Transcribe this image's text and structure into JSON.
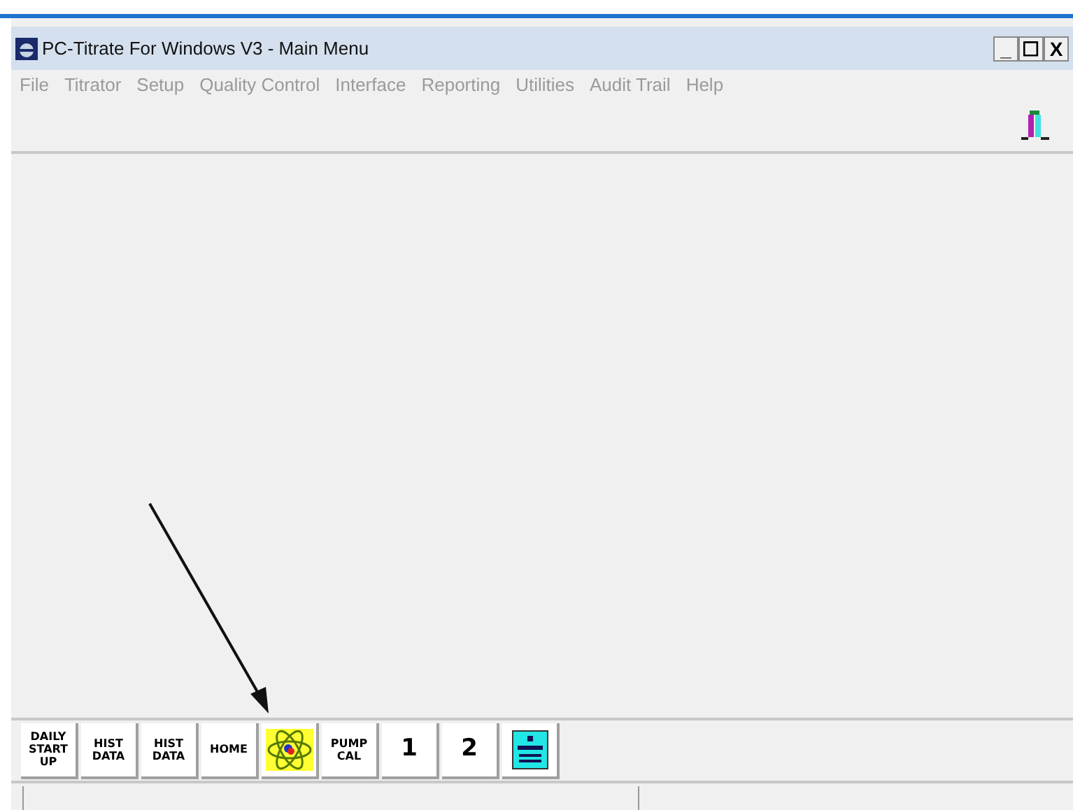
{
  "window": {
    "title": "PC-Titrate For Windows V3 - Main Menu",
    "controls": [
      "_",
      "☐",
      "X"
    ]
  },
  "menu": [
    {
      "label": "File",
      "disabled": true
    },
    {
      "label": "Titrator",
      "disabled": true
    },
    {
      "label": "Setup",
      "disabled": true
    },
    {
      "label": "Quality Control",
      "disabled": true
    },
    {
      "label": "Interface",
      "disabled": true
    },
    {
      "label": "Reporting",
      "disabled": true
    },
    {
      "label": "Utilities",
      "disabled": true
    },
    {
      "label": "Audit Trail",
      "disabled": true
    },
    {
      "label": "Help",
      "disabled": true
    }
  ],
  "buttons": [
    {
      "kind": "text",
      "lines": [
        "DAILY",
        "START",
        "UP"
      ]
    },
    {
      "kind": "text",
      "lines": [
        "HIST",
        "DATA"
      ]
    },
    {
      "kind": "text",
      "lines": [
        "HIST",
        "DATA"
      ]
    },
    {
      "kind": "text",
      "lines": [
        "HOME"
      ]
    },
    {
      "kind": "atom"
    },
    {
      "kind": "text",
      "lines": [
        "PUMP",
        "CAL"
      ]
    },
    {
      "kind": "big",
      "lines": [
        "1"
      ]
    },
    {
      "kind": "big",
      "lines": [
        "2"
      ]
    },
    {
      "kind": "element"
    }
  ]
}
